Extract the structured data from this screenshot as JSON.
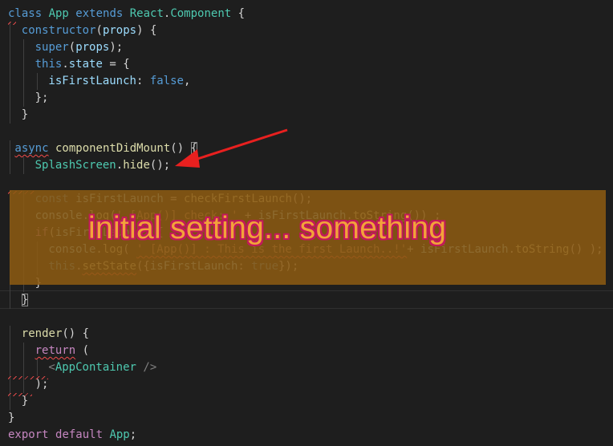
{
  "editor": {
    "lines": [
      {
        "row": 0,
        "indent": 0,
        "tokens": [
          {
            "t": "class ",
            "c": "keyword"
          },
          {
            "t": "App ",
            "c": "class"
          },
          {
            "t": "extends ",
            "c": "keyword"
          },
          {
            "t": "React",
            "c": "class"
          },
          {
            "t": ".",
            "c": "plain"
          },
          {
            "t": "Component",
            "c": "class"
          },
          {
            "t": " {",
            "c": "plain"
          }
        ]
      },
      {
        "row": 1,
        "indent": 1,
        "tokens": [
          {
            "t": "constructor",
            "c": "keyword"
          },
          {
            "t": "(",
            "c": "plain"
          },
          {
            "t": "props",
            "c": "variable"
          },
          {
            "t": ") {",
            "c": "plain"
          }
        ]
      },
      {
        "row": 2,
        "indent": 2,
        "tokens": [
          {
            "t": "super",
            "c": "keyword"
          },
          {
            "t": "(",
            "c": "plain"
          },
          {
            "t": "props",
            "c": "variable"
          },
          {
            "t": ");",
            "c": "plain"
          }
        ]
      },
      {
        "row": 3,
        "indent": 2,
        "tokens": [
          {
            "t": "this",
            "c": "keyword"
          },
          {
            "t": ".",
            "c": "plain"
          },
          {
            "t": "state",
            "c": "variable"
          },
          {
            "t": " = {",
            "c": "plain"
          }
        ]
      },
      {
        "row": 4,
        "indent": 3,
        "tokens": [
          {
            "t": "isFirstLaunch",
            "c": "variable"
          },
          {
            "t": ": ",
            "c": "plain"
          },
          {
            "t": "false",
            "c": "keyword"
          },
          {
            "t": ",",
            "c": "plain"
          }
        ]
      },
      {
        "row": 5,
        "indent": 2,
        "tokens": [
          {
            "t": "};",
            "c": "plain"
          }
        ]
      },
      {
        "row": 6,
        "indent": 1,
        "tokens": [
          {
            "t": "}",
            "c": "plain"
          }
        ]
      },
      {
        "row": 7,
        "indent": 0,
        "tokens": []
      },
      {
        "row": 8,
        "indent": 1,
        "offset": -1,
        "tokens": [
          {
            "t": "async",
            "c": "keyword",
            "squiggle": true
          },
          {
            "t": " ",
            "c": "plain"
          },
          {
            "t": "componentDidMount",
            "c": "function"
          },
          {
            "t": "() ",
            "c": "plain"
          },
          {
            "t": "{",
            "c": "plain",
            "box": true
          }
        ]
      },
      {
        "row": 9,
        "indent": 2,
        "tokens": [
          {
            "t": "SplashScreen",
            "c": "class"
          },
          {
            "t": ".",
            "c": "plain"
          },
          {
            "t": "hide",
            "c": "function"
          },
          {
            "t": "();",
            "c": "plain"
          }
        ]
      },
      {
        "row": 10,
        "indent": 0,
        "tokens": []
      },
      {
        "row": 11,
        "indent": 2,
        "tokens": [
          {
            "t": "const ",
            "c": "keyword"
          },
          {
            "t": "isFirstLaunch",
            "c": "variable"
          },
          {
            "t": " = ",
            "c": "plain"
          },
          {
            "t": "checkFirstLaunch",
            "c": "function"
          },
          {
            "t": "();",
            "c": "plain"
          }
        ]
      },
      {
        "row": 12,
        "indent": 2,
        "tokens": [
          {
            "t": "console",
            "c": "variable"
          },
          {
            "t": ".",
            "c": "plain"
          },
          {
            "t": "log",
            "c": "function"
          },
          {
            "t": "(",
            "c": "plain"
          },
          {
            "t": "' [App()] check: '",
            "c": "string"
          },
          {
            "t": " + ",
            "c": "plain"
          },
          {
            "t": "isFirstLaunch",
            "c": "variable"
          },
          {
            "t": ".",
            "c": "plain"
          },
          {
            "t": "toString",
            "c": "function"
          },
          {
            "t": "()) ;",
            "c": "plain"
          }
        ]
      },
      {
        "row": 13,
        "indent": 2,
        "tokens": [
          {
            "t": "if",
            "c": "control"
          },
          {
            "t": "(",
            "c": "plain"
          },
          {
            "t": "isFirstLaunch",
            "c": "variable"
          },
          {
            "t": ") {",
            "c": "plain"
          }
        ]
      },
      {
        "row": 14,
        "indent": 3,
        "tokens": [
          {
            "t": "console",
            "c": "variable"
          },
          {
            "t": ".",
            "c": "plain"
          },
          {
            "t": "log",
            "c": "function"
          },
          {
            "t": "( ",
            "c": "plain"
          },
          {
            "t": "' [App()] : This is the first Launch..!'",
            "c": "string",
            "squiggle": true
          },
          {
            "t": "+ ",
            "c": "plain"
          },
          {
            "t": "isFirstLaunch",
            "c": "variable"
          },
          {
            "t": ".",
            "c": "plain"
          },
          {
            "t": "toString",
            "c": "function"
          },
          {
            "t": "() );",
            "c": "plain"
          }
        ]
      },
      {
        "row": 15,
        "indent": 3,
        "tokens": [
          {
            "t": "this",
            "c": "keyword"
          },
          {
            "t": ".",
            "c": "plain"
          },
          {
            "t": "setState",
            "c": "function",
            "squiggle": true
          },
          {
            "t": "({",
            "c": "plain"
          },
          {
            "t": "isFirstLaunch",
            "c": "variable"
          },
          {
            "t": ": ",
            "c": "plain"
          },
          {
            "t": "true",
            "c": "keyword"
          },
          {
            "t": "});",
            "c": "plain"
          }
        ]
      },
      {
        "row": 16,
        "indent": 2,
        "tokens": [
          {
            "t": "}",
            "c": "plain"
          }
        ]
      },
      {
        "row": 17,
        "indent": 1,
        "tokens": [
          {
            "t": "}",
            "c": "plain",
            "box": true
          }
        ]
      },
      {
        "row": 18,
        "indent": 0,
        "tokens": []
      },
      {
        "row": 19,
        "indent": 1,
        "tokens": [
          {
            "t": "render",
            "c": "function"
          },
          {
            "t": "() {",
            "c": "plain"
          }
        ]
      },
      {
        "row": 20,
        "indent": 2,
        "tokens": [
          {
            "t": "return",
            "c": "control",
            "squiggle": true
          },
          {
            "t": " (",
            "c": "plain"
          }
        ]
      },
      {
        "row": 21,
        "indent": 3,
        "tokens": [
          {
            "t": "<",
            "c": "tag-bracket"
          },
          {
            "t": "AppContainer",
            "c": "class"
          },
          {
            "t": " />",
            "c": "tag-bracket"
          }
        ]
      },
      {
        "row": 22,
        "indent": 2,
        "tokens": [
          {
            "t": ");",
            "c": "plain"
          }
        ]
      },
      {
        "row": 23,
        "indent": 1,
        "tokens": [
          {
            "t": "}",
            "c": "plain"
          }
        ]
      },
      {
        "row": 24,
        "indent": 0,
        "tokens": [
          {
            "t": "}",
            "c": "plain"
          }
        ]
      },
      {
        "row": 25,
        "indent": 0,
        "tokens": [
          {
            "t": "export ",
            "c": "control"
          },
          {
            "t": "default ",
            "c": "control"
          },
          {
            "t": "App",
            "c": "class"
          },
          {
            "t": ";",
            "c": "plain"
          }
        ]
      }
    ]
  },
  "annotation": {
    "overlay_text": "initial setting... something",
    "highlight_color": "#8b5a12",
    "arrow_color": "#e8201f",
    "overlay_text_color": "#f2a33a",
    "overlay_outline_color": "#c2185b"
  },
  "theme": {
    "background": "#1e1e1e",
    "indent_guide": "#404040",
    "squiggle": "#f14c4c"
  }
}
